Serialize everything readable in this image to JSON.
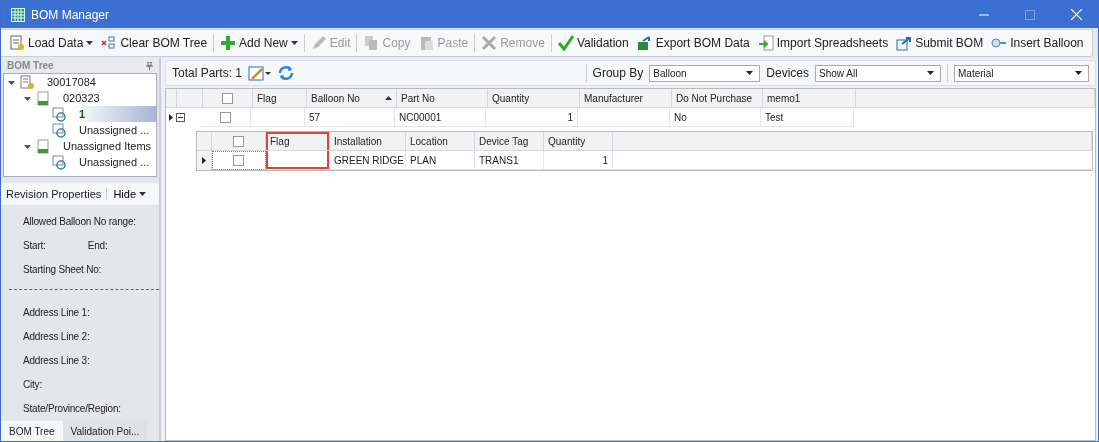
{
  "window": {
    "title": "BOM Manager"
  },
  "toolbar": [
    {
      "label": "Load Data",
      "dropdown": true,
      "disabled": false,
      "separator_before": false
    },
    {
      "label": "Clear BOM Tree",
      "dropdown": false,
      "disabled": false,
      "separator_before": false
    },
    {
      "label": "Add New",
      "dropdown": true,
      "disabled": false,
      "separator_before": true
    },
    {
      "label": "Edit",
      "dropdown": false,
      "disabled": true,
      "separator_before": true
    },
    {
      "label": "Copy",
      "dropdown": false,
      "disabled": true,
      "separator_before": true
    },
    {
      "label": "Paste",
      "dropdown": false,
      "disabled": true,
      "separator_before": false
    },
    {
      "label": "Remove",
      "dropdown": false,
      "disabled": true,
      "separator_before": true
    },
    {
      "label": "Validation",
      "dropdown": false,
      "disabled": false,
      "separator_before": true
    },
    {
      "label": "Export BOM Data",
      "dropdown": false,
      "disabled": false,
      "separator_before": false
    },
    {
      "label": "Import Spreadsheets",
      "dropdown": false,
      "disabled": false,
      "separator_before": false
    },
    {
      "label": "Submit BOM",
      "dropdown": false,
      "disabled": false,
      "separator_before": false
    },
    {
      "label": "Insert Balloon",
      "dropdown": false,
      "disabled": false,
      "separator_before": false
    }
  ],
  "bom_tree": {
    "title": "BOM Tree",
    "nodes": [
      {
        "label": "30017084",
        "kind": "document",
        "expanded": true,
        "selected": false,
        "children": [
          {
            "label": "020323",
            "kind": "sheet",
            "expanded": true,
            "selected": false,
            "children": [
              {
                "label": "1",
                "kind": "revision",
                "selected": true
              },
              {
                "label": "Unassigned ...",
                "kind": "revision",
                "selected": false
              }
            ]
          },
          {
            "label": "Unassigned Items",
            "kind": "sheet",
            "expanded": true,
            "selected": false,
            "children": [
              {
                "label": "Unassigned ...",
                "kind": "revision",
                "selected": false
              }
            ]
          }
        ]
      }
    ]
  },
  "revision_properties": {
    "title": "Revision Properties",
    "hide_button": "Hide",
    "rows": [
      {
        "kind": "labels",
        "labels": [
          "Allowed Balloon No range:"
        ]
      },
      {
        "kind": "labels",
        "labels": [
          "Start:",
          "End:"
        ]
      },
      {
        "kind": "labels",
        "labels": [
          "Starting Sheet No:"
        ]
      },
      {
        "kind": "divider"
      },
      {
        "kind": "labels",
        "labels": [
          "Address Line 1:"
        ]
      },
      {
        "kind": "labels",
        "labels": [
          "Address Line 2:"
        ]
      },
      {
        "kind": "labels",
        "labels": [
          "Address Line 3:"
        ]
      },
      {
        "kind": "labels",
        "labels": [
          "City:"
        ]
      },
      {
        "kind": "labels",
        "labels": [
          "State/Province/Region:"
        ]
      }
    ]
  },
  "bottom_tabs": [
    {
      "label": "BOM Tree",
      "selected": true
    },
    {
      "label": "Validation Poi...",
      "selected": false
    }
  ],
  "grid_toolbar": {
    "total_parts": "Total Parts: 1",
    "group_by": {
      "label": "Group By",
      "value": "Balloon"
    },
    "devices": {
      "label": "Devices",
      "value": "Show All"
    },
    "view": {
      "value": "Material"
    }
  },
  "main_table": {
    "select_all_checked": false,
    "columns": [
      {
        "label": "Flag",
        "kind": "text",
        "sorted": false
      },
      {
        "label": "Balloon No",
        "kind": "text",
        "sorted": true
      },
      {
        "label": "Part No",
        "kind": "text",
        "sorted": false
      },
      {
        "label": "Quantity",
        "kind": "number",
        "sorted": false
      },
      {
        "label": "Manufacturer",
        "kind": "text",
        "sorted": false
      },
      {
        "label": "Do Not Purchase",
        "kind": "text",
        "sorted": false
      },
      {
        "label": "memo1",
        "kind": "text",
        "sorted": false
      }
    ],
    "rows": [
      {
        "expanded": true,
        "checked": false,
        "cells": [
          "",
          "57",
          "NC00001",
          "1",
          "",
          "No",
          "Test"
        ]
      }
    ]
  },
  "detail_table": {
    "select_all_checked": false,
    "columns": [
      {
        "label": "Flag",
        "kind": "text",
        "highlighted": true
      },
      {
        "label": "Installation",
        "kind": "text",
        "highlighted": false
      },
      {
        "label": "Location",
        "kind": "text",
        "highlighted": false
      },
      {
        "label": "Device Tag",
        "kind": "text",
        "highlighted": false
      },
      {
        "label": "Quantity",
        "kind": "number",
        "highlighted": false
      }
    ],
    "rows": [
      {
        "checked": false,
        "cells": [
          "",
          "GREEN RIDGE",
          "PLAN",
          "TRANS1",
          "1"
        ]
      }
    ]
  }
}
